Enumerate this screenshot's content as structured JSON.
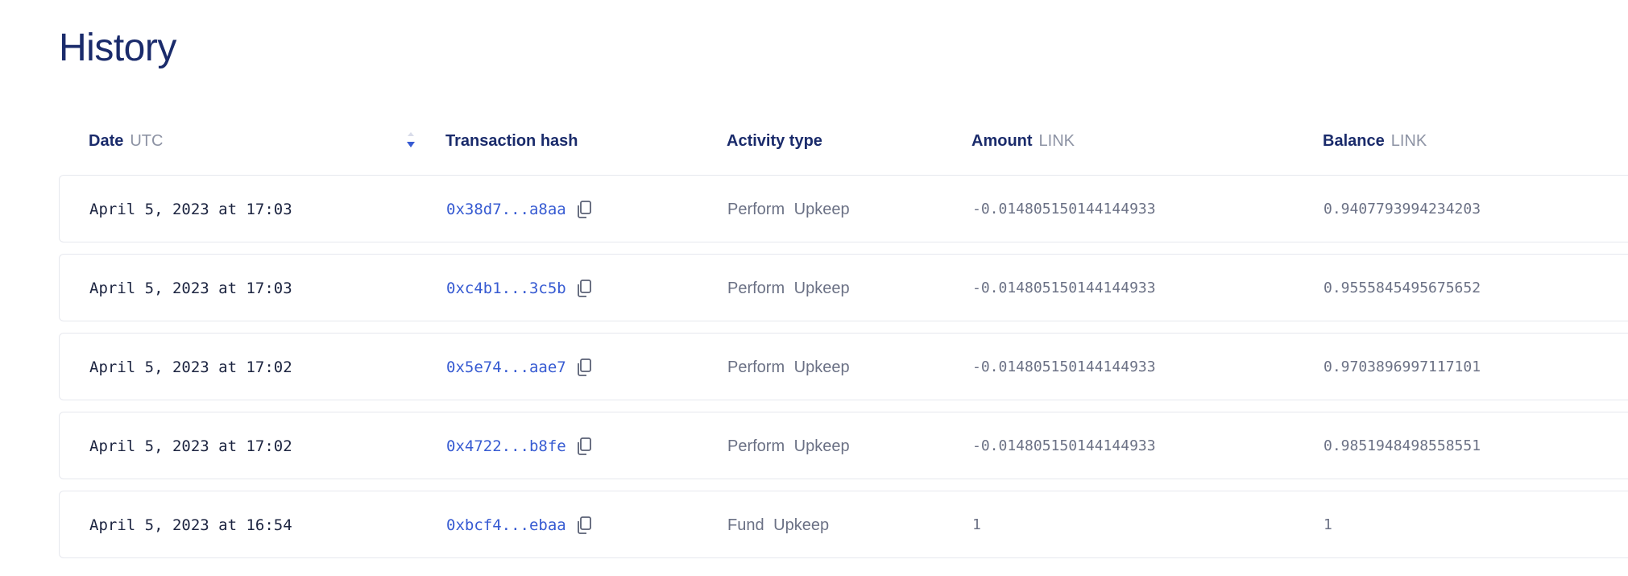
{
  "page": {
    "title": "History"
  },
  "table": {
    "columns": {
      "date": {
        "label": "Date",
        "unit": "UTC"
      },
      "hash": {
        "label": "Transaction hash"
      },
      "activity": {
        "label": "Activity type"
      },
      "amount": {
        "label": "Amount",
        "unit": "LINK"
      },
      "balance": {
        "label": "Balance",
        "unit": "LINK"
      }
    },
    "sort_icon": "sort-descending-icon",
    "copy_icon": "copy-icon",
    "rows": [
      {
        "date": "April 5, 2023 at 17:03",
        "hash": "0x38d7...a8aa",
        "activity": "Perform Upkeep",
        "amount": "-0.014805150144144933",
        "balance": "0.9407793994234203"
      },
      {
        "date": "April 5, 2023 at 17:03",
        "hash": "0xc4b1...3c5b",
        "activity": "Perform Upkeep",
        "amount": "-0.014805150144144933",
        "balance": "0.9555845495675652"
      },
      {
        "date": "April 5, 2023 at 17:02",
        "hash": "0x5e74...aae7",
        "activity": "Perform Upkeep",
        "amount": "-0.014805150144144933",
        "balance": "0.9703896997117101"
      },
      {
        "date": "April 5, 2023 at 17:02",
        "hash": "0x4722...b8fe",
        "activity": "Perform Upkeep",
        "amount": "-0.014805150144144933",
        "balance": "0.9851948498558551"
      },
      {
        "date": "April 5, 2023 at 16:54",
        "hash": "0xbcf4...ebaa",
        "activity": "Fund Upkeep",
        "amount": "1",
        "balance": "1"
      }
    ]
  },
  "colors": {
    "title": "#1a2b6b",
    "link": "#375bd2",
    "muted": "#6b7185",
    "border": "#e6e8ee"
  }
}
